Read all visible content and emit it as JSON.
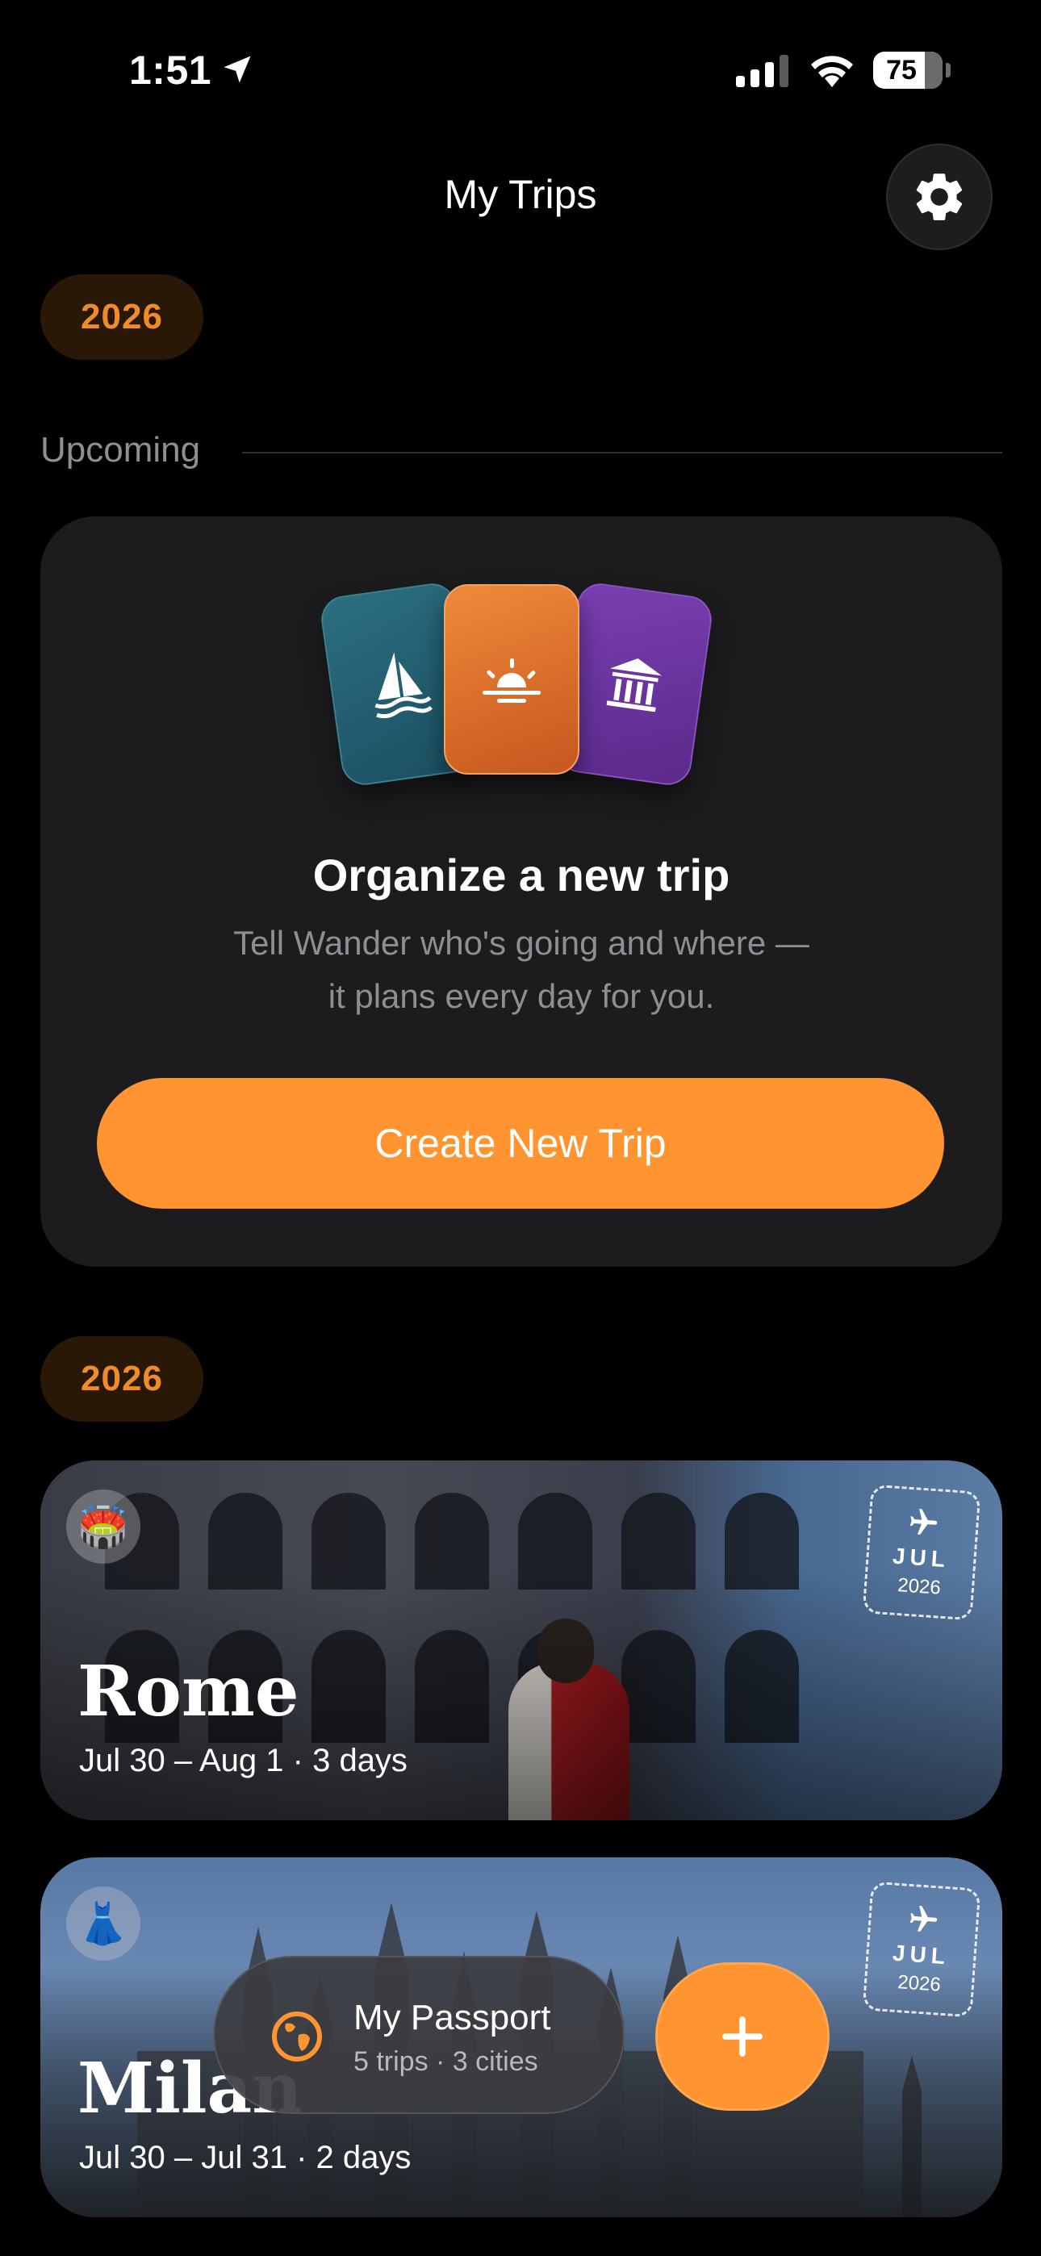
{
  "status_bar": {
    "time": "1:51",
    "battery": "75"
  },
  "header": {
    "title": "My Trips",
    "settings_icon": "gear-icon"
  },
  "year_pill_1": "2026",
  "section": {
    "label": "Upcoming"
  },
  "create_card": {
    "art_icons": [
      "sailboat-icon",
      "sunrise-icon",
      "museum-icon"
    ],
    "title": "Organize a new trip",
    "subtitle_line1": "Tell Wander who's going and where —",
    "subtitle_line2": "it plans every day for you.",
    "button_label": "Create New Trip"
  },
  "year_pill_2": "2026",
  "trips": [
    {
      "city": "Rome",
      "dates": "Jul 30 – Aug 1 · 3 days",
      "emoji": "🏟️",
      "stamp_month": "JUL",
      "stamp_year": "2026"
    },
    {
      "city": "Milan",
      "dates": "Jul 30 – Jul 31 · 2 days",
      "emoji": "👗",
      "stamp_month": "JUL",
      "stamp_year": "2026"
    }
  ],
  "passport": {
    "title": "My Passport",
    "subtitle": "5 trips · 3 cities",
    "icon": "globe-icon"
  },
  "fab": {
    "icon": "plus-icon"
  },
  "colors": {
    "accent": "#ff9430",
    "year_text": "#f08b2a",
    "card_bg": "#1c1c1e"
  }
}
